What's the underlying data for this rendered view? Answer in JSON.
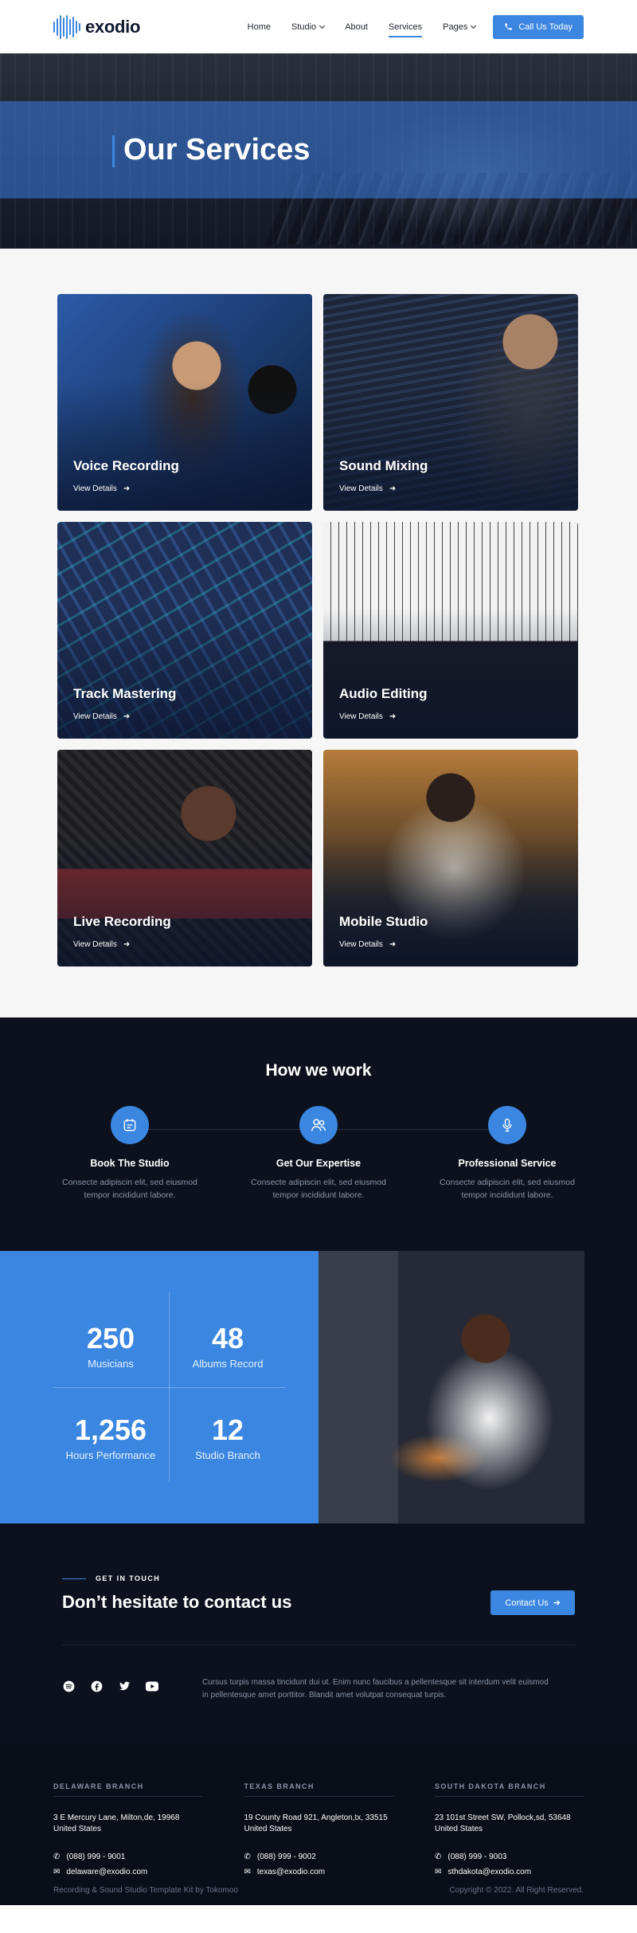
{
  "header": {
    "logo_text": "exodio",
    "nav": [
      {
        "label": "Home",
        "has_dropdown": false,
        "active": false
      },
      {
        "label": "Studio",
        "has_dropdown": true,
        "active": false
      },
      {
        "label": "About",
        "has_dropdown": false,
        "active": false
      },
      {
        "label": "Services",
        "has_dropdown": false,
        "active": true
      },
      {
        "label": "Pages",
        "has_dropdown": true,
        "active": false
      }
    ],
    "cta_label": "Call Us Today",
    "cta_icon": "phone-icon"
  },
  "hero": {
    "title": "Our Services"
  },
  "services": {
    "link_label": "View Details",
    "cards": [
      {
        "title": "Voice Recording"
      },
      {
        "title": "Sound Mixing"
      },
      {
        "title": "Track Mastering"
      },
      {
        "title": "Audio Editing"
      },
      {
        "title": "Live Recording"
      },
      {
        "title": "Mobile Studio"
      }
    ]
  },
  "how": {
    "title": "How we work",
    "steps": [
      {
        "icon": "calendar-icon",
        "title": "Book The Studio",
        "text": "Consecte adipiscin elit, sed eiusmod tempor incididunt labore."
      },
      {
        "icon": "users-icon",
        "title": "Get Our Expertise",
        "text": "Consecte adipiscin elit, sed eiusmod tempor incididunt labore."
      },
      {
        "icon": "microphone-icon",
        "title": "Professional Service",
        "text": "Consecte adipiscin elit, sed eiusmod tempor incididunt labore."
      }
    ]
  },
  "stats": [
    {
      "value": "250",
      "label": "Musicians"
    },
    {
      "value": "48",
      "label": "Albums Record"
    },
    {
      "value": "1,256",
      "label": "Hours Performance"
    },
    {
      "value": "12",
      "label": "Studio Branch"
    }
  ],
  "contact": {
    "eyebrow": "GET IN TOUCH",
    "title": "Don’t hesitate to contact us",
    "button_label": "Contact Us",
    "socials": [
      "spotify-icon",
      "facebook-icon",
      "twitter-icon",
      "youtube-icon"
    ],
    "text": "Cursus turpis massa tincidunt dui ut. Enim nunc faucibus a pellentesque sit interdum velit euismod in pellentesque  amet porttitor. Blandit amet volutpat consequat turpis."
  },
  "footer": {
    "branches": [
      {
        "title": "DELAWARE BRANCH",
        "address": "3 E Mercury Lane, Milton,de, 19968 United States",
        "phone": "(088) 999 - 9001",
        "email": "delaware@exodio.com"
      },
      {
        "title": "TEXAS BRANCH",
        "address": "19 County Road 921, Angleton,tx, 33515 United States",
        "phone": "(088) 999 - 9002",
        "email": "texas@exodio.com"
      },
      {
        "title": "SOUTH DAKOTA BRANCH",
        "address": "23 101st Street SW, Pollock,sd, 53648 United States",
        "phone": "(088) 999 - 9003",
        "email": "sthdakota@exodio.com"
      }
    ],
    "credit": "Recording & Sound Studio Template Kit by Tokomoo",
    "copyright": "Copyright © 2022. All Right Reserved."
  },
  "colors": {
    "accent": "#3a86e0",
    "dark": "#0c111d",
    "light_bg": "#f6f6f6"
  }
}
